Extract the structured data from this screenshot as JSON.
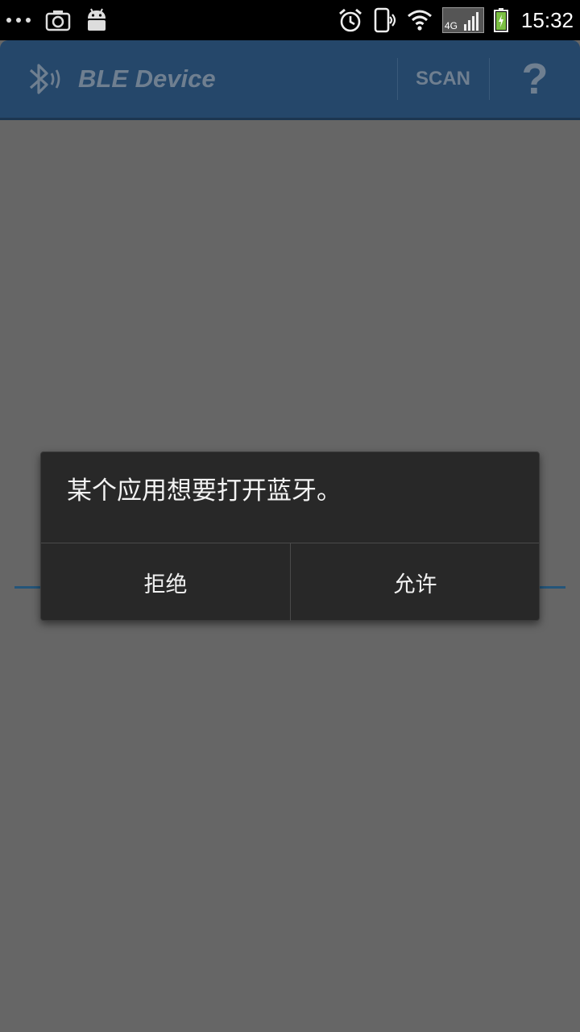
{
  "status_bar": {
    "time": "15:32",
    "network_type": "4G",
    "icons": [
      "more-dots-icon",
      "screenshot-icon",
      "android-icon",
      "alarm-icon",
      "vibrate-icon",
      "wifi-icon",
      "signal-icon",
      "battery-charging-icon"
    ]
  },
  "action_bar": {
    "title": "BLE Device",
    "scan_label": "SCAN",
    "help_label": "?",
    "logo_icon": "bluetooth-icon"
  },
  "dialog": {
    "message": "某个应用想要打开蓝牙。",
    "deny_label": "拒绝",
    "allow_label": "允许"
  },
  "colors": {
    "action_bar": "#25476a",
    "dimmed_background": "#666666",
    "dialog_background": "#282828"
  }
}
